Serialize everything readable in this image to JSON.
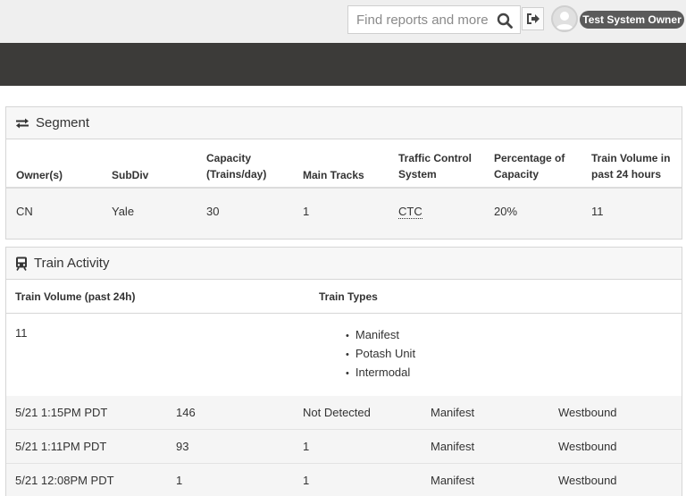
{
  "header": {
    "search_placeholder": "Find reports and more",
    "user_name": "Test System Owner"
  },
  "segment": {
    "title": "Segment",
    "columns": [
      "Owner(s)",
      "SubDiv",
      "Capacity (Trains/day)",
      "Main Tracks",
      "Traffic Control System",
      "Percentage of Capacity",
      "Train Volume in past 24 hours"
    ],
    "values": [
      "CN",
      "Yale",
      "30",
      "1",
      "CTC",
      "20%",
      "11"
    ]
  },
  "activity": {
    "title": "Train Activity",
    "col_volume": "Train Volume (past 24h)",
    "col_types": "Train Types",
    "volume": "11",
    "types": [
      "Manifest",
      "Potash Unit",
      "Intermodal"
    ],
    "rows": [
      {
        "time": "5/21 1:15PM PDT",
        "id": "146",
        "detection": "Not Detected",
        "type": "Manifest",
        "direction": "Westbound"
      },
      {
        "time": "5/21 1:11PM PDT",
        "id": "93",
        "detection": "1",
        "type": "Manifest",
        "direction": "Westbound"
      },
      {
        "time": "5/21 12:08PM PDT",
        "id": "1",
        "detection": "1",
        "type": "Manifest",
        "direction": "Westbound"
      }
    ]
  }
}
